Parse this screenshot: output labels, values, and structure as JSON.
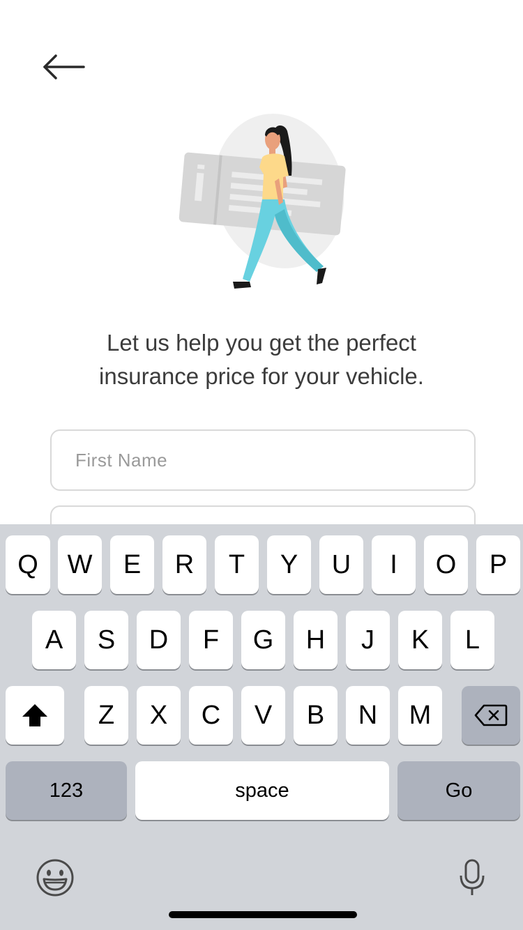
{
  "header": {
    "back_icon": "arrow-left-icon"
  },
  "illustration": {
    "description_icon": "woman-walking-with-ticket-illustration"
  },
  "intro": {
    "line1": "Let us help you get the perfect",
    "line2": "insurance price for your vehicle."
  },
  "form": {
    "first_name": {
      "placeholder": "First Name",
      "value": ""
    },
    "second_field": {
      "placeholder": "",
      "value": ""
    }
  },
  "keyboard": {
    "row1": [
      "Q",
      "W",
      "E",
      "R",
      "T",
      "Y",
      "U",
      "I",
      "O",
      "P"
    ],
    "row2": [
      "A",
      "S",
      "D",
      "F",
      "G",
      "H",
      "J",
      "K",
      "L"
    ],
    "row3": [
      "Z",
      "X",
      "C",
      "V",
      "B",
      "N",
      "M"
    ],
    "shift_icon": "shift-arrow-icon",
    "delete_icon": "backspace-icon",
    "numbers_label": "123",
    "space_label": "space",
    "go_label": "Go",
    "emoji_icon": "emoji-icon",
    "mic_icon": "microphone-icon"
  },
  "colors": {
    "keyboard_bg": "#d1d4d9",
    "key_bg": "#ffffff",
    "key_dark_bg": "#adb2bd",
    "text_primary": "#3c3c3c",
    "placeholder": "#9a9a9a",
    "field_border": "#d9d9d9"
  }
}
